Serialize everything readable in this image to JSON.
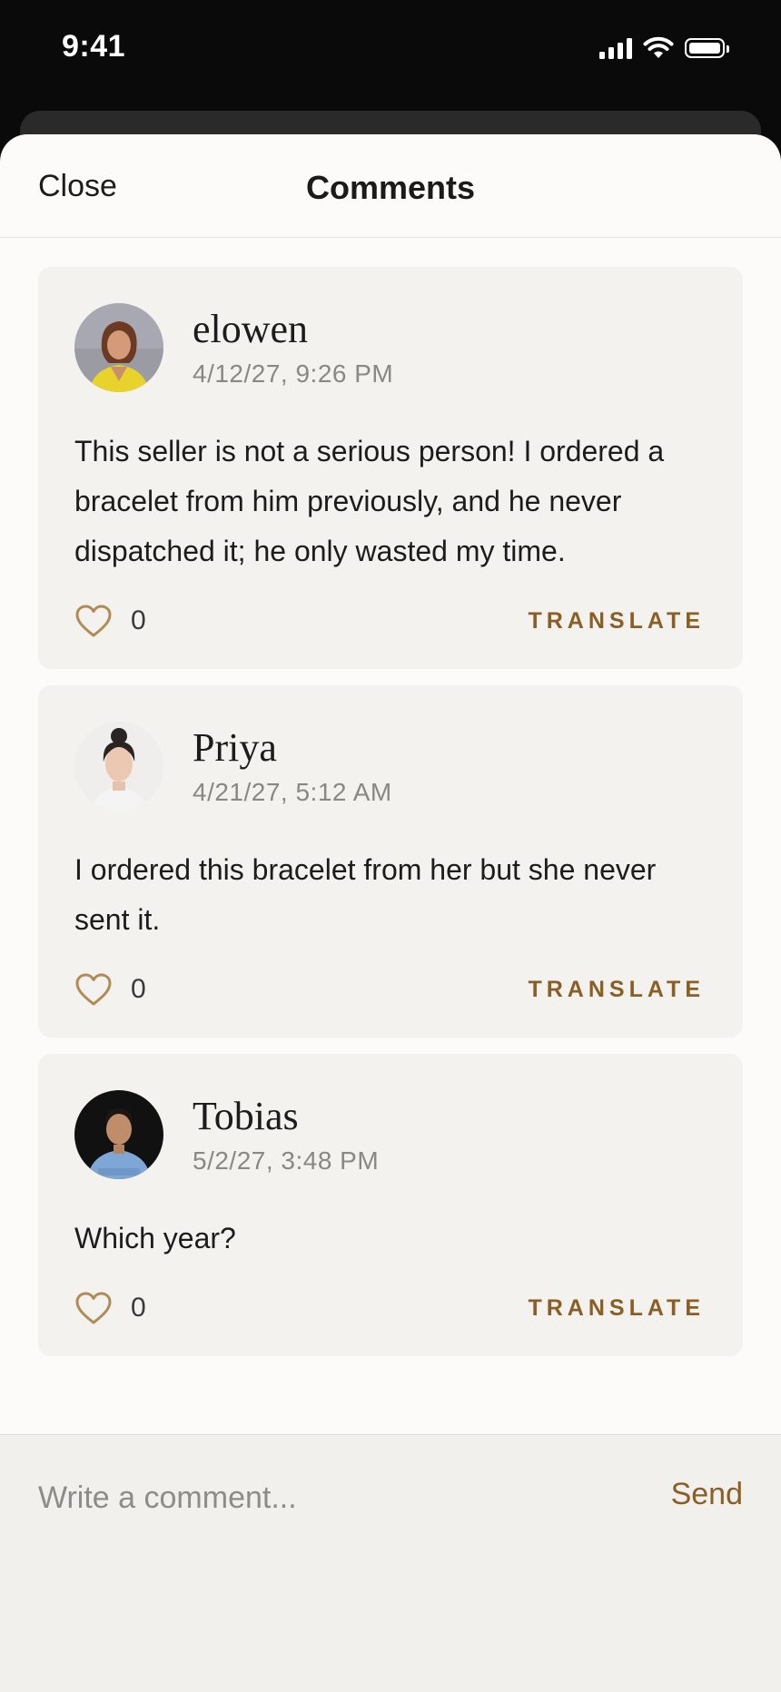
{
  "status_bar": {
    "time": "9:41"
  },
  "header": {
    "close_label": "Close",
    "title": "Comments"
  },
  "comments": [
    {
      "author": "elowen",
      "timestamp": "4/12/27, 9:26 PM",
      "text": "This seller is not a serious person! I ordered a bracelet from him previously, and he never dispatched it; he only wasted my time.",
      "likes": "0",
      "translate_label": "TRANSLATE"
    },
    {
      "author": "Priya",
      "timestamp": "4/21/27, 5:12 AM",
      "text": "I ordered this bracelet from her but she never sent it.",
      "likes": "0",
      "translate_label": "TRANSLATE"
    },
    {
      "author": "Tobias",
      "timestamp": "5/2/27, 3:48 PM",
      "text": "Which year?",
      "likes": "0",
      "translate_label": "TRANSLATE"
    }
  ],
  "composer": {
    "placeholder": "Write a comment...",
    "send_label": "Send"
  },
  "colors": {
    "accent": "#8a5e24",
    "heart": "#b08b55",
    "card_background": "#f3f2ef",
    "sheet_background": "#fcfbf9"
  }
}
